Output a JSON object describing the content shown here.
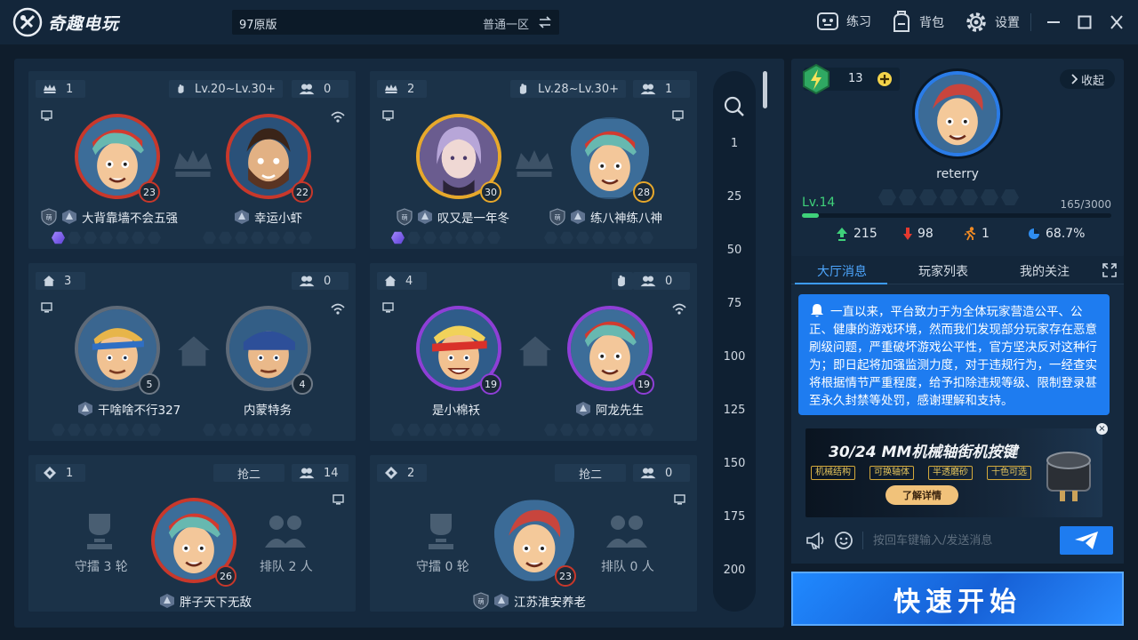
{
  "app": {
    "name": "奇趣电玩"
  },
  "server": {
    "name": "97原版",
    "zone": "普通一区"
  },
  "toolbar": {
    "practice": "练习",
    "bag": "背包",
    "settings": "设置"
  },
  "colors": {
    "accent": "#1e7cf0",
    "level": "#3fd17a",
    "panel": "#1b3248"
  },
  "rooms": [
    {
      "id": "1",
      "level_range": "Lv.20~Lv.30+",
      "spectators": "0",
      "p1": {
        "name": "大背靠墙不会五强",
        "level": "23"
      },
      "p2": {
        "name": "幸运小虾",
        "level": "22"
      }
    },
    {
      "id": "2",
      "level_range": "Lv.28~Lv.30+",
      "spectators": "1",
      "p1": {
        "name": "叹又是一年冬",
        "level": "30"
      },
      "p2": {
        "name": "练八神练八神",
        "level": "28"
      }
    },
    {
      "id": "3",
      "spectators": "0",
      "p1": {
        "name": "干啥啥不行327",
        "level": "5"
      },
      "p2": {
        "name": "内蒙特务",
        "level": "4"
      }
    },
    {
      "id": "4",
      "spectators": "0",
      "p1": {
        "name": "是小棉袄",
        "level": "19"
      },
      "p2": {
        "name": "阿龙先生",
        "level": "19"
      }
    },
    {
      "id": "1",
      "mode": "抢二",
      "spectators": "14",
      "defend": "守擂 3 轮",
      "queue": "排队 2 人",
      "p1": {
        "name": "胖子天下无敌",
        "level": "26"
      }
    },
    {
      "id": "2",
      "mode": "抢二",
      "spectators": "0",
      "defend": "守擂 0 轮",
      "queue": "排队 0 人",
      "p1": {
        "name": "江苏淮安养老",
        "level": "23"
      }
    }
  ],
  "filter": {
    "levels": [
      "1",
      "25",
      "50",
      "75",
      "100",
      "125",
      "150",
      "175",
      "200"
    ]
  },
  "profile": {
    "energy": "13",
    "collapse": "收起",
    "name": "reterry",
    "level": "Lv.14",
    "exp_text": "165/3000",
    "exp_fraction": 0.055,
    "wins": "215",
    "losses": "98",
    "escapes": "1",
    "win_rate": "68.7%"
  },
  "chat": {
    "tabs": [
      "大厅消息",
      "玩家列表",
      "我的关注"
    ],
    "notice": "一直以来，平台致力于为全体玩家营造公平、公正、健康的游戏环境，然而我们发现部分玩家存在恶意刷级问题，严重破坏游戏公平性，官方坚决反对这种行为；即日起将加强监测力度，对于违规行为，一经查实将根据情节严重程度，给予扣除违规等级、限制登录甚至永久封禁等处罚，感谢理解和支持。",
    "ad": {
      "title": "30/24 MM机械轴街机按键",
      "tags": [
        "机械结构",
        "可换轴体",
        "半透磨砂",
        "十色可选"
      ],
      "cta": "了解详情"
    },
    "input_placeholder": "按回车键输入/发送消息"
  },
  "start": {
    "label": "快速开始"
  }
}
